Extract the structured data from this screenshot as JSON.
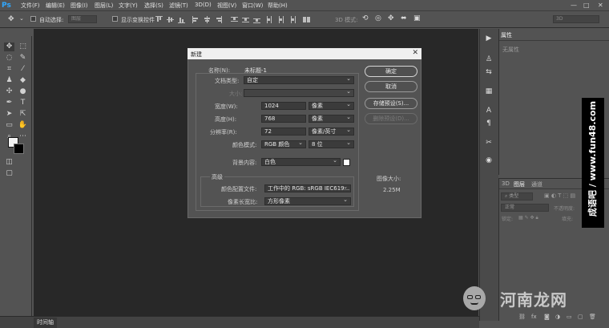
{
  "app": {
    "logo": "Ps"
  },
  "menubar": {
    "items": [
      "文件(F)",
      "编辑(E)",
      "图像(I)",
      "图层(L)",
      "文字(Y)",
      "选择(S)",
      "滤镜(T)",
      "3D(D)",
      "视图(V)",
      "窗口(W)",
      "帮助(H)"
    ],
    "window_controls": [
      "—",
      "□",
      "✕"
    ]
  },
  "optionsbar": {
    "auto_select_label": "自动选择:",
    "auto_select_value": "图层",
    "show_transform_label": "显示变换控件",
    "mode_3d_label": "3D 模式:",
    "workspace_value": "3D"
  },
  "tools": {
    "items": [
      "move-tool",
      "marquee-tool",
      "lasso-tool",
      "quick-select-tool",
      "crop-tool",
      "eyedropper-tool",
      "healing-tool",
      "brush-tool",
      "stamp-tool",
      "history-brush-tool",
      "eraser-tool",
      "gradient-tool",
      "blur-tool",
      "dodge-tool",
      "pen-tool",
      "type-tool",
      "path-select-tool",
      "shape-tool",
      "hand-tool",
      "zoom-tool"
    ],
    "foreground_color": "#f2f2f2",
    "background_color": "#000000"
  },
  "dialog": {
    "title": "新建",
    "close": "✕",
    "name_label": "名称(N):",
    "name_value": "未标题-1",
    "preset_label": "文档类型:",
    "preset_value": "自定",
    "size_label": "大小:",
    "size_value": "",
    "width_label": "宽度(W):",
    "width_value": "1024",
    "width_unit": "像素",
    "height_label": "高度(H):",
    "height_value": "768",
    "height_unit": "像素",
    "resolution_label": "分辨率(R):",
    "resolution_value": "72",
    "resolution_unit": "像素/英寸",
    "color_mode_label": "颜色模式:",
    "color_mode_value": "RGB 颜色",
    "bit_depth_value": "8 位",
    "background_label": "背景内容:",
    "background_value": "白色",
    "advanced_label": "高级",
    "color_profile_label": "颜色配置文件:",
    "color_profile_value": "工作中的 RGB: sRGB IEC619...",
    "pixel_aspect_label": "像素长宽比:",
    "pixel_aspect_value": "方形像素",
    "image_size_label": "图像大小:",
    "image_size_value": "2.25M",
    "buttons": {
      "ok": "确定",
      "cancel": "取消",
      "save_preset": "存储预设(S)...",
      "delete_preset": "删除预设(D)..."
    }
  },
  "properties_panel": {
    "tab": "属性",
    "empty_text": "无属性"
  },
  "layers_panel": {
    "tabs": [
      "3D",
      "图层",
      "通道"
    ],
    "filter_value": "类型",
    "blend_mode_value": "正常",
    "opacity_label": "不透明度:",
    "lock_label": "锁定:",
    "fill_label": "填充:"
  },
  "statusbar": {
    "timeline_tab": "时间轴"
  },
  "watermarks": {
    "vertical_text": "成语吧 / www.fun48.com",
    "logo_text": "河南龙网"
  }
}
